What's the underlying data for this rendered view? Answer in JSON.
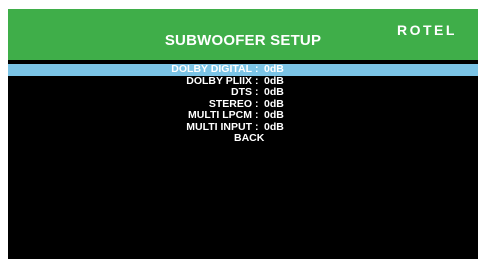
{
  "header": {
    "title": "SUBWOOFER SETUP",
    "brand": "ROTEL",
    "background_color": "#3fae49"
  },
  "menu": {
    "selected_color": "#7bc4e6",
    "items": [
      {
        "label": "DOLBY DIGITAL",
        "separator": ":",
        "value": "0dB",
        "selected": true
      },
      {
        "label": "DOLBY PLIIX",
        "separator": ":",
        "value": "0dB",
        "selected": false
      },
      {
        "label": "DTS",
        "separator": ":",
        "value": "0dB",
        "selected": false
      },
      {
        "label": "STEREO",
        "separator": ":",
        "value": "0dB",
        "selected": false
      },
      {
        "label": "MULTI LPCM",
        "separator": ":",
        "value": "0dB",
        "selected": false
      },
      {
        "label": "MULTI INPUT",
        "separator": ":",
        "value": "0dB",
        "selected": false
      }
    ],
    "back_label": "BACK"
  }
}
